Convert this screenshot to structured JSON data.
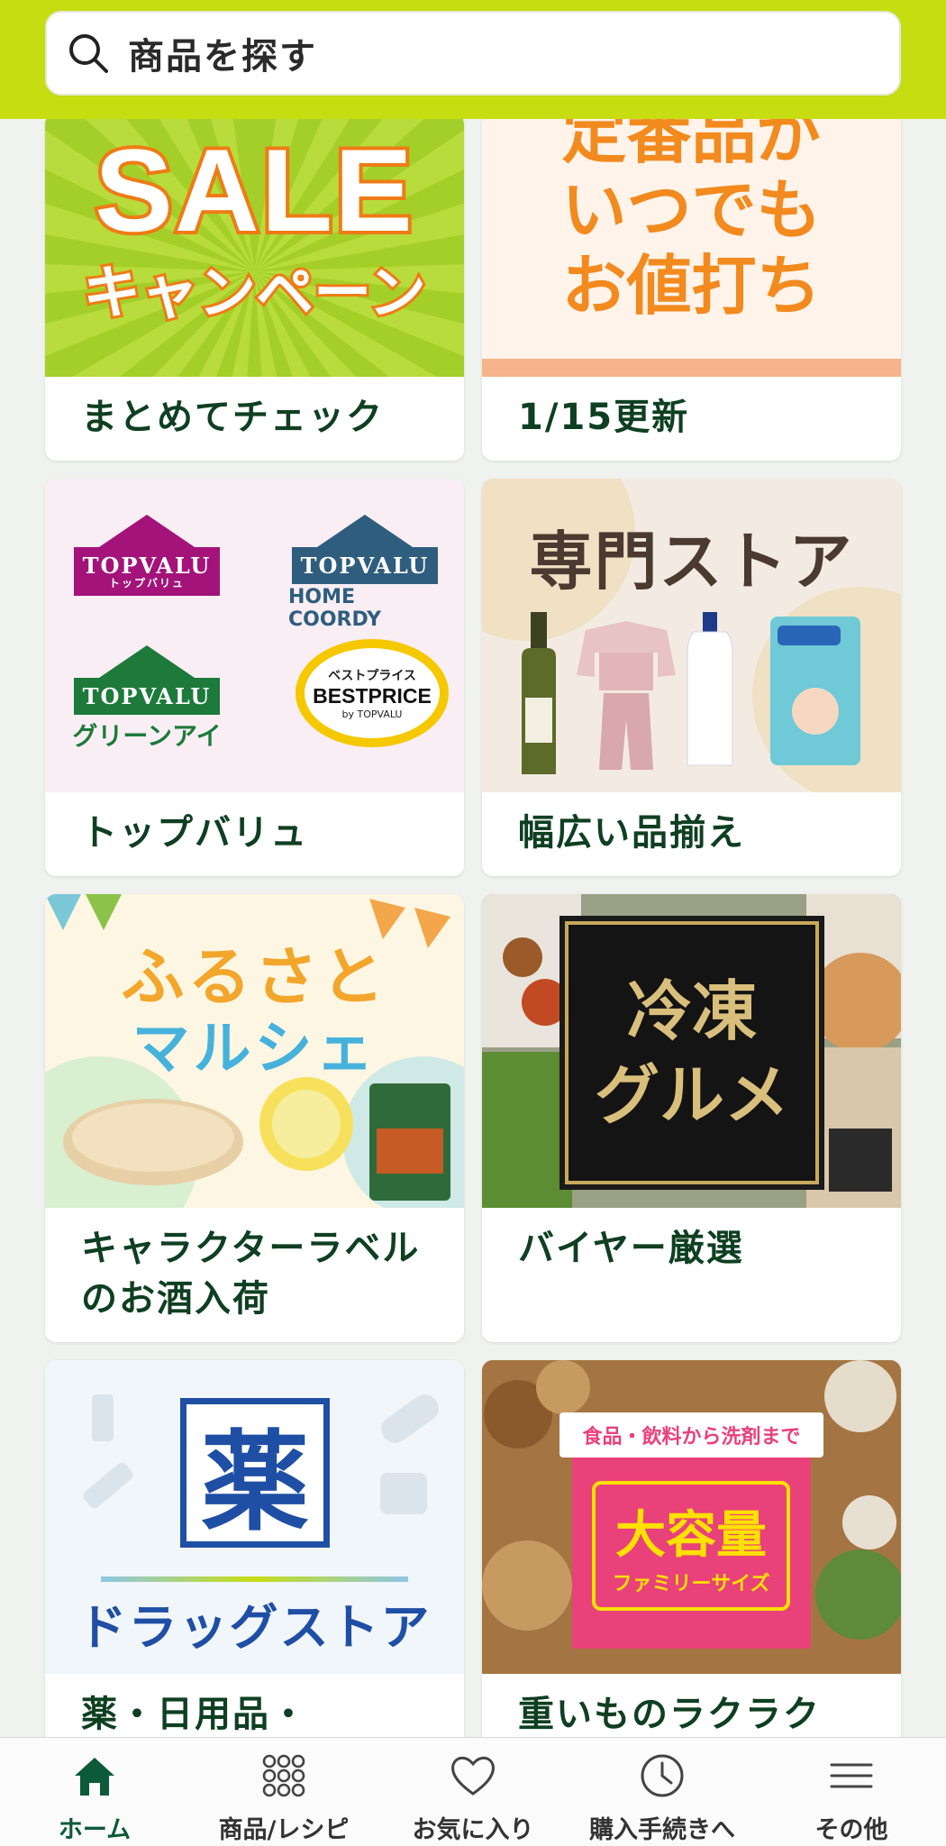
{
  "search": {
    "placeholder": "商品を探す"
  },
  "cards": [
    {
      "image": {
        "big": "SALE",
        "sub": "キャンペーン"
      },
      "label": "まとめてチェック"
    },
    {
      "image": {
        "lines": [
          "定番品が",
          "いつでも",
          "お値打ち"
        ]
      },
      "label": "1/15更新"
    },
    {
      "image": {
        "logos": [
          {
            "brand": "TOPVALU",
            "sub": "トップバリュ",
            "color": "#a3137a"
          },
          {
            "brand": "TOPVALU",
            "extra": "HOME COORDY",
            "color": "#2f5d7e"
          },
          {
            "brand": "TOPVALU",
            "extra": "グリーンアイ",
            "color": "#1d7a3b"
          },
          {
            "brand": "BESTPRICE",
            "top": "ベストプライス",
            "bottom": "by TOPVALU",
            "color": "#f5c800"
          }
        ]
      },
      "label": "トップバリュ"
    },
    {
      "image": {
        "title": "専門ストア"
      },
      "label": "幅広い品揃え"
    },
    {
      "image": {
        "line1": "ふるさと",
        "line2": "マルシェ"
      },
      "label": "キャラクターラベルのお酒入荷"
    },
    {
      "image": {
        "line1": "冷凍",
        "line2": "グルメ"
      },
      "label": "バイヤー厳選"
    },
    {
      "image": {
        "kanji": "薬",
        "text": "ドラッグストア"
      },
      "label": "薬・日用品・"
    },
    {
      "image": {
        "top": "食品・飲料から洗剤まで",
        "big": "大容量",
        "small": "ファミリーサイズ"
      },
      "label": "重いものラクラク"
    }
  ],
  "nav": [
    {
      "label": "ホーム",
      "icon": "home-icon",
      "active": true
    },
    {
      "label": "商品/レシピ",
      "icon": "grid-icon",
      "active": false
    },
    {
      "label": "お気に入り",
      "icon": "heart-icon",
      "active": false
    },
    {
      "label": "購入手続きへ",
      "icon": "clock-icon",
      "active": false
    },
    {
      "label": "その他",
      "icon": "menu-icon",
      "active": false
    }
  ],
  "colors": {
    "brand": "#c6dd12",
    "label_text": "#0f3f22",
    "nav_active": "#0c5a3a"
  }
}
